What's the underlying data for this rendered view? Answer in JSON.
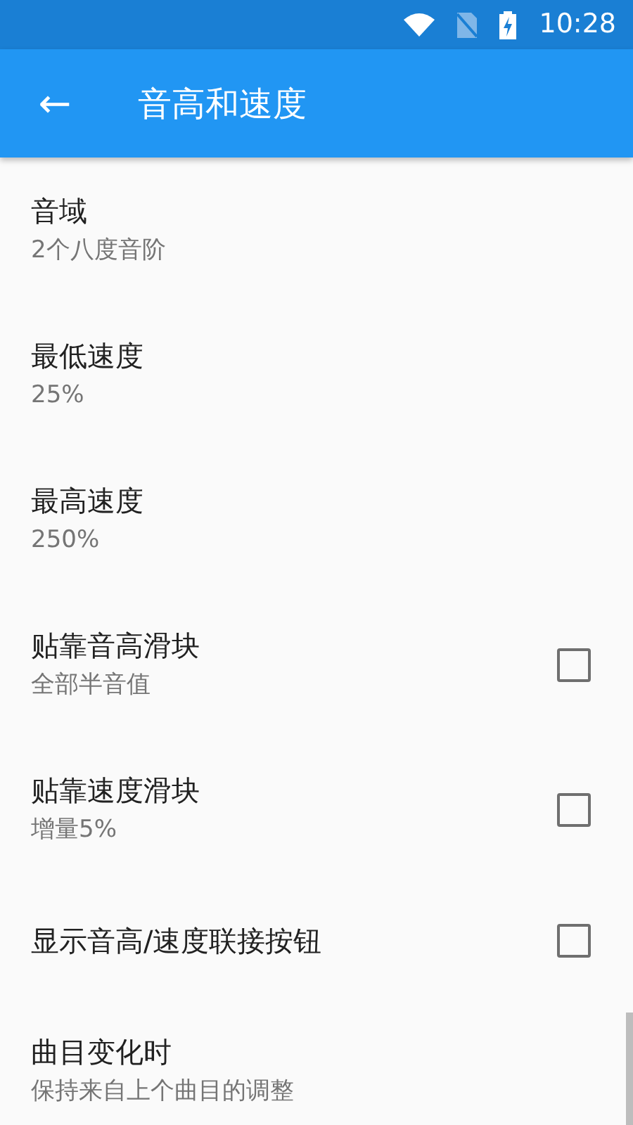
{
  "status_bar": {
    "time": "10:28"
  },
  "toolbar": {
    "back_icon": "←",
    "title": "音高和速度"
  },
  "preferences": [
    {
      "kind": "text",
      "title": "音域",
      "summary": "2个八度音阶"
    },
    {
      "kind": "text",
      "title": "最低速度",
      "summary": "25%"
    },
    {
      "kind": "text",
      "title": "最高速度",
      "summary": "250%"
    },
    {
      "kind": "checkbox",
      "title": "贴靠音高滑块",
      "summary": "全部半音值",
      "checked": false
    },
    {
      "kind": "checkbox",
      "title": "贴靠速度滑块",
      "summary": "增量5%",
      "checked": false
    },
    {
      "kind": "checkbox",
      "title": "显示音高/速度联接按钮",
      "checked": false
    },
    {
      "kind": "text",
      "title": "曲目变化时",
      "summary": "保持来自上个曲目的调整"
    }
  ]
}
